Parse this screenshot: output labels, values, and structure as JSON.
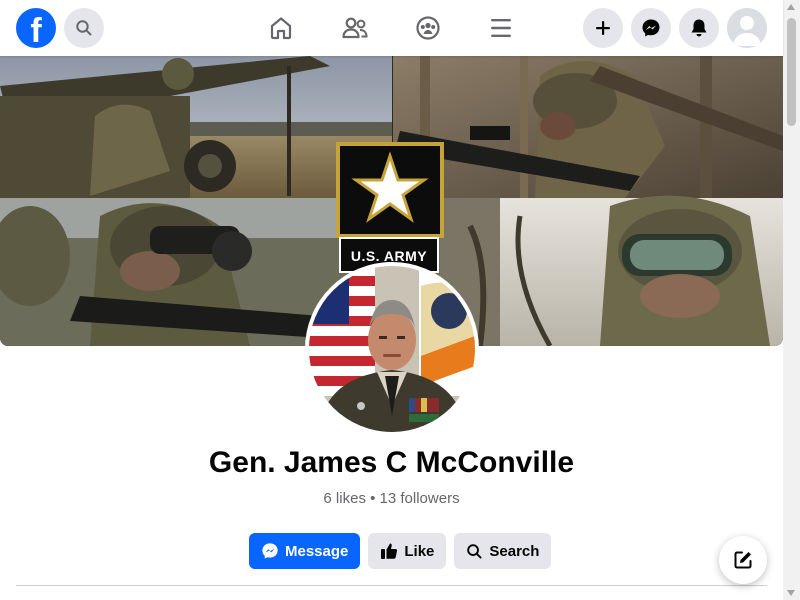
{
  "app": {
    "logo_letter": "f",
    "brand_color": "#0866ff"
  },
  "nav": {
    "left_icons": [
      "facebook-logo-icon",
      "search-icon"
    ],
    "center_icons": [
      "home-icon",
      "friends-icon",
      "groups-icon",
      "menu-icon"
    ],
    "right_icons": [
      "plus-icon",
      "messenger-icon",
      "bell-icon",
      "profile-avatar-icon"
    ]
  },
  "cover": {
    "emblem_text": "U.S. ARMY"
  },
  "profile": {
    "name": "Gen. James C McConville",
    "stats": "6 likes • 13 followers"
  },
  "actions": {
    "message_label": "Message",
    "like_label": "Like",
    "search_label": "Search"
  },
  "floating": {
    "compose_icon": "compose-icon"
  }
}
